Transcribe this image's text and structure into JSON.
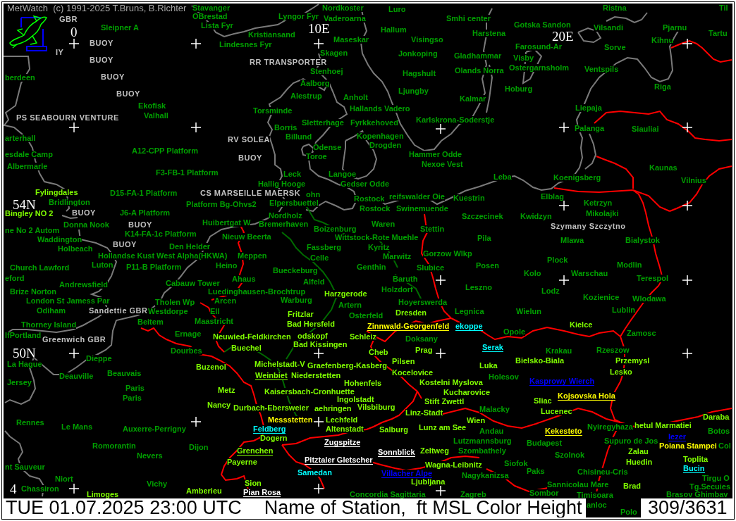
{
  "title": "MetWatch  (c) 1991-2025 T.Bruns, B.Richter",
  "map": {
    "grid_labels": [
      "0",
      "10E",
      "20E",
      "54N",
      "50N",
      "4"
    ],
    "ship_labels": [
      "GBR",
      "BUOY",
      "IY",
      "BUOY",
      "RR TRANSPORTER",
      "BUOY",
      "BUOY",
      "PS SEABOURN VENTURE",
      "RV SOLEA",
      "BUOY",
      "CS MARSEILLE MAERSK",
      "BUOY",
      "BUOY",
      "Szymany Szczytno",
      "BUOY",
      "Sandettie GBR",
      "Greenwich GBR"
    ],
    "station_labels": [
      {
        "name": "Stavanger",
        "color": "#00a000"
      },
      {
        "name": "Nordkoster",
        "color": "#00a000"
      },
      {
        "name": "Luro",
        "color": "#00a000"
      },
      {
        "name": "Ristna",
        "color": "#00a000"
      },
      {
        "name": "Til",
        "color": "#00a000"
      },
      {
        "name": "OBrestad",
        "color": "#00a000"
      },
      {
        "name": "Lyngor Fyr",
        "color": "#00a000"
      },
      {
        "name": "Vaderoarna",
        "color": "#00a000"
      },
      {
        "name": "Smhi center",
        "color": "#00a000"
      },
      {
        "name": "Sleipner A",
        "color": "#00a000"
      },
      {
        "name": "Lista Fyr",
        "color": "#00a000"
      },
      {
        "name": "Hallum",
        "color": "#00a000"
      },
      {
        "name": "Gotska Sandon",
        "color": "#00a000"
      },
      {
        "name": "Vilsandi",
        "color": "#00a000"
      },
      {
        "name": "Pjarnu",
        "color": "#00a000"
      },
      {
        "name": "Kristiansand",
        "color": "#00a000"
      },
      {
        "name": "Harstena",
        "color": "#00a000"
      },
      {
        "name": "Tartu",
        "color": "#00a000"
      },
      {
        "name": "Maseskar",
        "color": "#00a000"
      },
      {
        "name": "Visingso",
        "color": "#00a000"
      },
      {
        "name": "Kihnu",
        "color": "#00a000"
      },
      {
        "name": "Lindesnes Fyr",
        "color": "#00a000"
      },
      {
        "name": "Farosund-Ar",
        "color": "#00a000"
      },
      {
        "name": "Sorve",
        "color": "#00a000"
      },
      {
        "name": "Skagen",
        "color": "#00a000"
      },
      {
        "name": "Jonkoping",
        "color": "#00a000"
      },
      {
        "name": "Gladhammar",
        "color": "#00a000"
      },
      {
        "name": "Visby",
        "color": "#00a000"
      },
      {
        "name": "Stenhoej",
        "color": "#00a000"
      },
      {
        "name": "Hagshult",
        "color": "#00a000"
      },
      {
        "name": "Olands Norra",
        "color": "#00a000"
      },
      {
        "name": "Ostergarnsholm",
        "color": "#00a000"
      },
      {
        "name": "Ventspils",
        "color": "#00a000"
      },
      {
        "name": "berdeen",
        "color": "#00a000"
      },
      {
        "name": "Aalborg",
        "color": "#00a000"
      },
      {
        "name": "Riga",
        "color": "#00a000"
      },
      {
        "name": "Ljungby",
        "color": "#00a000"
      },
      {
        "name": "Hoburg",
        "color": "#00a000"
      },
      {
        "name": "Alestrup",
        "color": "#00a000"
      },
      {
        "name": "Anholt",
        "color": "#00a000"
      },
      {
        "name": "Kalmar",
        "color": "#00a000"
      },
      {
        "name": "Ekofisk",
        "color": "#00a000"
      },
      {
        "name": "Torsminde",
        "color": "#00a000"
      },
      {
        "name": "Hallands Vadero",
        "color": "#00a000"
      },
      {
        "name": "Liepaja",
        "color": "#00a000"
      },
      {
        "name": "Valhall",
        "color": "#00a000"
      },
      {
        "name": "Sletterhage",
        "color": "#00a000"
      },
      {
        "name": "Fyrkkehoved",
        "color": "#00a000"
      },
      {
        "name": "Karlskrona-Soderstje",
        "color": "#00a000"
      },
      {
        "name": "Borris",
        "color": "#00a000"
      },
      {
        "name": "Palanga",
        "color": "#00a000"
      },
      {
        "name": "Siauliai",
        "color": "#00a000"
      },
      {
        "name": "arterhall",
        "color": "#00a000"
      },
      {
        "name": "Billund",
        "color": "#00a000"
      },
      {
        "name": "Kopenhagen",
        "color": "#00a000"
      },
      {
        "name": "Odense",
        "color": "#00a000"
      },
      {
        "name": "Drogden",
        "color": "#00a000"
      },
      {
        "name": "esdale Camp",
        "color": "#00a000"
      },
      {
        "name": "A12-CPP Platform",
        "color": "#00a000"
      },
      {
        "name": "Toroe",
        "color": "#00a000"
      },
      {
        "name": "Hammer Odde",
        "color": "#00a000"
      },
      {
        "name": "Albermarle",
        "color": "#00a000"
      },
      {
        "name": "Nexoe Vest",
        "color": "#00a000"
      },
      {
        "name": "Kaunas",
        "color": "#00a000"
      },
      {
        "name": "F3-FB-1 Platform",
        "color": "#00a000"
      },
      {
        "name": "Leck",
        "color": "#00a000"
      },
      {
        "name": "Langoe",
        "color": "#00a000"
      },
      {
        "name": "Leba",
        "color": "#00a000"
      },
      {
        "name": "Koenigsberg",
        "color": "#00a000"
      },
      {
        "name": "Hallig Hooge",
        "color": "#00a000"
      },
      {
        "name": "Gedser Odde",
        "color": "#00a000"
      },
      {
        "name": "Vilnius",
        "color": "#00a000"
      },
      {
        "name": "Fylingdales",
        "color": "#80ff00"
      },
      {
        "name": "D15-FA-1 Platform",
        "color": "#00a000"
      },
      {
        "name": "ohn",
        "color": "#00a000"
      },
      {
        "name": "Rostock",
        "color": "#00a000"
      },
      {
        "name": "reifswalder Oie",
        "color": "#00a000"
      },
      {
        "name": "Kuestrin",
        "color": "#00a000"
      },
      {
        "name": "Elblag",
        "color": "#00a000"
      },
      {
        "name": "Bridlington",
        "color": "#00a000"
      },
      {
        "name": "Platform Bg-Ohvs2",
        "color": "#00a000"
      },
      {
        "name": "Elpersbuettel",
        "color": "#00a000"
      },
      {
        "name": "Ketrzyn",
        "color": "#00a000"
      },
      {
        "name": "Rostock",
        "color": "#00a000"
      },
      {
        "name": "Swinemuende",
        "color": "#00a000"
      },
      {
        "name": "Bingley NO 2",
        "color": "#80ff00"
      },
      {
        "name": "J6-A Platform",
        "color": "#00a000"
      },
      {
        "name": "Nordholz",
        "color": "#00a000"
      },
      {
        "name": "Szczecinek",
        "color": "#00a000"
      },
      {
        "name": "Kwidzyn",
        "color": "#00a000"
      },
      {
        "name": "Mikolajki",
        "color": "#00a000"
      },
      {
        "name": "Donna Nook",
        "color": "#00a000"
      },
      {
        "name": "Huibertgat W",
        "color": "#00a000"
      },
      {
        "name": "Bremerhaven",
        "color": "#00a000"
      },
      {
        "name": "Waren",
        "color": "#00a000"
      },
      {
        "name": "ne No 2 Autom",
        "color": "#00a000"
      },
      {
        "name": "Boizenburg",
        "color": "#00a000"
      },
      {
        "name": "Stettin",
        "color": "#00a000"
      },
      {
        "name": "K14-FA-1c Platform",
        "color": "#00a000"
      },
      {
        "name": "Waddington",
        "color": "#00a000"
      },
      {
        "name": "Nieuw Beerta",
        "color": "#00a000"
      },
      {
        "name": "Wittstock-Rote Muehle",
        "color": "#00a000"
      },
      {
        "name": "Pila",
        "color": "#00a000"
      },
      {
        "name": "Mlawa",
        "color": "#00a000"
      },
      {
        "name": "Bialystok",
        "color": "#00a000"
      },
      {
        "name": "Holbeach",
        "color": "#00a000"
      },
      {
        "name": "Den Helder",
        "color": "#00a000"
      },
      {
        "name": "Fassberg",
        "color": "#00a000"
      },
      {
        "name": "Kyritz",
        "color": "#00a000"
      },
      {
        "name": "Hollandse Kust West Alpha(HKWA)",
        "color": "#00a000"
      },
      {
        "name": "Meppen",
        "color": "#00a000"
      },
      {
        "name": "Marwitz",
        "color": "#00a000"
      },
      {
        "name": "Gorzow Wlkp",
        "color": "#00a000"
      },
      {
        "name": "Celle",
        "color": "#00a000"
      },
      {
        "name": "Plock",
        "color": "#00a000"
      },
      {
        "name": "Church Lawford",
        "color": "#00a000"
      },
      {
        "name": "Luton",
        "color": "#00a000"
      },
      {
        "name": "P11-B Platform",
        "color": "#00a000"
      },
      {
        "name": "Heino",
        "color": "#00a000"
      },
      {
        "name": "Genthin",
        "color": "#00a000"
      },
      {
        "name": "Slubice",
        "color": "#00a000"
      },
      {
        "name": "Posen",
        "color": "#00a000"
      },
      {
        "name": "Modlin",
        "color": "#00a000"
      },
      {
        "name": "Bueckeburg",
        "color": "#00a000"
      },
      {
        "name": "Kolo",
        "color": "#00a000"
      },
      {
        "name": "Warschau",
        "color": "#00a000"
      },
      {
        "name": "eford",
        "color": "#00a000"
      },
      {
        "name": "Ahaus",
        "color": "#00a000"
      },
      {
        "name": "Alfeld",
        "color": "#00a000"
      },
      {
        "name": "Baruth",
        "color": "#00a000"
      },
      {
        "name": "Terespol",
        "color": "#00a000"
      },
      {
        "name": "Andrewsfield",
        "color": "#00a000"
      },
      {
        "name": "Cabauw Tower",
        "color": "#00a000"
      },
      {
        "name": "Leszno",
        "color": "#00a000"
      },
      {
        "name": "Brize Norton",
        "color": "#00a000"
      },
      {
        "name": "Luedinghausen-Brochtrup",
        "color": "#00a000"
      },
      {
        "name": "Harzgerode",
        "color": "#80ff00"
      },
      {
        "name": "Holzdorf",
        "color": "#00a000"
      },
      {
        "name": "Lodz",
        "color": "#00a000"
      },
      {
        "name": "London St Jamess Par",
        "color": "#00a000"
      },
      {
        "name": "Tholen Wp",
        "color": "#00a000"
      },
      {
        "name": "Arcen",
        "color": "#00a000"
      },
      {
        "name": "Warburg",
        "color": "#00a000"
      },
      {
        "name": "Artern",
        "color": "#00a000"
      },
      {
        "name": "Hoyerswerda",
        "color": "#00a000"
      },
      {
        "name": "Kozienice",
        "color": "#00a000"
      },
      {
        "name": "Wlodawa",
        "color": "#00a000"
      },
      {
        "name": "Odiham",
        "color": "#00a000"
      },
      {
        "name": "Westdorpe",
        "color": "#00a000"
      },
      {
        "name": "Ell",
        "color": "#00a000"
      },
      {
        "name": "Fritzlar",
        "color": "#80ff00"
      },
      {
        "name": "Osterfeld",
        "color": "#00a000"
      },
      {
        "name": "Dresden",
        "color": "#80ff00"
      },
      {
        "name": "Legnica",
        "color": "#00a000"
      },
      {
        "name": "Wielun",
        "color": "#00a000"
      },
      {
        "name": "Lublin",
        "color": "#00a000"
      },
      {
        "name": "Thorney Island",
        "color": "#00a000"
      },
      {
        "name": "Beitem",
        "color": "#00a000"
      },
      {
        "name": "Maastricht",
        "color": "#00a000"
      },
      {
        "name": "Bad Hersfeld",
        "color": "#80ff00"
      },
      {
        "name": "Kielce",
        "color": "#80ff00"
      },
      {
        "name": "lfPortland",
        "color": "#00a000"
      },
      {
        "name": "Ernage",
        "color": "#00a000"
      },
      {
        "name": "Neuwied-Feldkirchen",
        "color": "#80ff00"
      },
      {
        "name": "odskopf",
        "color": "#80ff00"
      },
      {
        "name": "Schleiz",
        "color": "#80ff00"
      },
      {
        "name": "Doksany",
        "color": "#00a000"
      },
      {
        "name": "Opole",
        "color": "#00a000"
      },
      {
        "name": "Zamosc",
        "color": "#00a000"
      },
      {
        "name": "Dourbes",
        "color": "#00a000"
      },
      {
        "name": "Buechel",
        "color": "#80ff00"
      },
      {
        "name": "Bad Kissingen",
        "color": "#80ff00"
      },
      {
        "name": "Cheb",
        "color": "#80ff00"
      },
      {
        "name": "Prag",
        "color": "#80ff00"
      },
      {
        "name": "Krakau",
        "color": "#00a000"
      },
      {
        "name": "Rzeszow",
        "color": "#00a000"
      },
      {
        "name": "La Hague",
        "color": "#00a000"
      },
      {
        "name": "Dieppe",
        "color": "#00a000"
      },
      {
        "name": "Buzenol",
        "color": "#80ff00"
      },
      {
        "name": "Michelstadt-V",
        "color": "#80ff00"
      },
      {
        "name": "Graefenberg-Kasberg",
        "color": "#80ff00"
      },
      {
        "name": "Pilsen",
        "color": "#80ff00"
      },
      {
        "name": "Luka",
        "color": "#80ff00"
      },
      {
        "name": "Bielsko-Biala",
        "color": "#80ff00"
      },
      {
        "name": "Przemysl",
        "color": "#80ff00"
      },
      {
        "name": "Deauville",
        "color": "#00a000"
      },
      {
        "name": "Beauvais",
        "color": "#00a000"
      },
      {
        "name": "Niederstetten",
        "color": "#80ff00"
      },
      {
        "name": "Kocelovice",
        "color": "#80ff00"
      },
      {
        "name": "Holesov",
        "color": "#00a000"
      },
      {
        "name": "Lesko",
        "color": "#80ff00"
      },
      {
        "name": "Jersey",
        "color": "#00a000"
      },
      {
        "name": "Hohenfels",
        "color": "#80ff00"
      },
      {
        "name": "Kostelni Myslova",
        "color": "#80ff00"
      },
      {
        "name": "Paris",
        "color": "#00a000"
      },
      {
        "name": "Metz",
        "color": "#80ff00"
      },
      {
        "name": "Kaisersbach-Cronhuette",
        "color": "#80ff00"
      },
      {
        "name": "Kucharovice",
        "color": "#80ff00"
      },
      {
        "name": "Paris",
        "color": "#00a000"
      },
      {
        "name": "Ingolstadt",
        "color": "#80ff00"
      },
      {
        "name": "Stift Zwettl",
        "color": "#80ff00"
      },
      {
        "name": "Sliac",
        "color": "#80ff00"
      },
      {
        "name": "Nancy",
        "color": "#80ff00"
      },
      {
        "name": "Durbach-Ebersweier",
        "color": "#80ff00"
      },
      {
        "name": "aehringen",
        "color": "#80ff00"
      },
      {
        "name": "Vilsbiburg",
        "color": "#80ff00"
      },
      {
        "name": "Linz-Stadt",
        "color": "#80ff00"
      },
      {
        "name": "Malacky",
        "color": "#00a000"
      },
      {
        "name": "Lucenec",
        "color": "#80ff00"
      },
      {
        "name": "Rennes",
        "color": "#00a000"
      },
      {
        "name": "Messstetten",
        "color": "#ffff00"
      },
      {
        "name": "Lechfeld",
        "color": "#80ff00"
      },
      {
        "name": "Wien",
        "color": "#80ff00"
      },
      {
        "name": "Daraba",
        "color": "#80ff00"
      },
      {
        "name": "Le Mans",
        "color": "#00a000"
      },
      {
        "name": "Auxerre-Perrigny",
        "color": "#00a000"
      },
      {
        "name": "Altenstadt",
        "color": "#80ff00"
      },
      {
        "name": "Salburg",
        "color": "#80ff00"
      },
      {
        "name": "Lunz am See",
        "color": "#80ff00"
      },
      {
        "name": "Andau",
        "color": "#00a000"
      },
      {
        "name": "Nyiregyhaza",
        "color": "#00a000"
      },
      {
        "name": "hetul Marmatiei",
        "color": "#80ff00"
      },
      {
        "name": "Botos",
        "color": "#00a000"
      },
      {
        "name": "Dogern",
        "color": "#80ff00"
      },
      {
        "name": "Lutzmannsburg",
        "color": "#00a000"
      },
      {
        "name": "Budapest",
        "color": "#00a000"
      },
      {
        "name": "Supuro de Jos",
        "color": "#00a000"
      },
      {
        "name": "Romorantin",
        "color": "#00a000"
      },
      {
        "name": "Dijon",
        "color": "#00a000"
      },
      {
        "name": "Poiana Stampei",
        "color": "#ffff00"
      },
      {
        "name": "Col",
        "color": "#00a000"
      },
      {
        "name": "Zeltweg",
        "color": "#80ff00"
      },
      {
        "name": "Szombathely",
        "color": "#00a000"
      },
      {
        "name": "Zalau",
        "color": "#80ff00"
      },
      {
        "name": "Nevers",
        "color": "#00a000"
      },
      {
        "name": "Szolnok",
        "color": "#00a000"
      },
      {
        "name": "Payerne",
        "color": "#80ff00"
      },
      {
        "name": "Wagna-Leibnitz",
        "color": "#80ff00"
      },
      {
        "name": "Siofok",
        "color": "#00a000"
      },
      {
        "name": "Huedin",
        "color": "#80ff00"
      },
      {
        "name": "Toplita",
        "color": "#80ff00"
      },
      {
        "name": "nt Sauveur",
        "color": "#00a000"
      },
      {
        "name": "Samedan",
        "color": "#00ffff"
      },
      {
        "name": "Nagykanizsa",
        "color": "#00a000"
      },
      {
        "name": "Paks",
        "color": "#00a000"
      },
      {
        "name": "Chisineu-Cris",
        "color": "#00a000"
      },
      {
        "name": "Niort",
        "color": "#00a000"
      },
      {
        "name": "Tirgu O",
        "color": "#00a000"
      },
      {
        "name": "Chassiron",
        "color": "#00a000"
      },
      {
        "name": "Vichy",
        "color": "#00a000"
      },
      {
        "name": "Amberieu",
        "color": "#80ff00"
      },
      {
        "name": "Sion",
        "color": "#80ff00"
      },
      {
        "name": "Ljubljana",
        "color": "#80ff00"
      },
      {
        "name": "Sannicolau Mare",
        "color": "#00a000"
      },
      {
        "name": "Brad",
        "color": "#80ff00"
      },
      {
        "name": "Tg.Secuies",
        "color": "#00a000"
      },
      {
        "name": "Limoges",
        "color": "#80ff00"
      },
      {
        "name": "Concordia Sagittaria",
        "color": "#00a000"
      },
      {
        "name": "Zagreb",
        "color": "#00a000"
      },
      {
        "name": "Sombor",
        "color": "#00a000"
      },
      {
        "name": "Timisoara",
        "color": "#00a000"
      },
      {
        "name": "Brasov Ghimbav",
        "color": "#00a000"
      },
      {
        "name": "anloc",
        "color": "#00a000"
      },
      {
        "name": "Polo",
        "color": "#00a000"
      }
    ],
    "underlined_station_labels": [
      {
        "name": "Zinnwald-Georgenfeld",
        "color": "#ffff00"
      },
      {
        "name": "ekoppe",
        "color": "#00ffff"
      },
      {
        "name": "Serak",
        "color": "#00ffff"
      },
      {
        "name": "Weinbiet",
        "color": "#80ff00"
      },
      {
        "name": "Kasprowy Wierch",
        "color": "#0000ff"
      },
      {
        "name": "Kojsovska Hola",
        "color": "#ffff00"
      },
      {
        "name": "Feldberg",
        "color": "#00ffff"
      },
      {
        "name": "Kekesteto",
        "color": "#ffff00"
      },
      {
        "name": "Iezer",
        "color": "#0000ff"
      },
      {
        "name": "Zugspitze",
        "color": "#ffffff"
      },
      {
        "name": "Grenchen",
        "color": "#80ff00"
      },
      {
        "name": "Sonnblick",
        "color": "#ffffff"
      },
      {
        "name": "Pitztaler Gletscher",
        "color": "#ffffff"
      },
      {
        "name": "Bucin",
        "color": "#00ffff"
      },
      {
        "name": "Villacher Alpe",
        "color": "#0000ff"
      },
      {
        "name": "Pian Rosa",
        "color": "#ffffff"
      }
    ]
  },
  "status_bar": {
    "date_time": "TUE 01.07.2025 23:00 UTC",
    "legend": "Name of Station,  ft MSL Color Height",
    "count": "309/3631"
  }
}
